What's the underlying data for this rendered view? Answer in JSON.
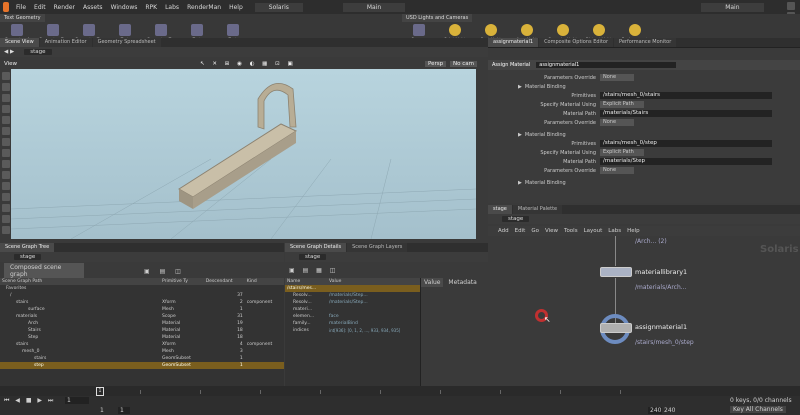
{
  "menubar": {
    "items": [
      "File",
      "Edit",
      "Render",
      "Assets",
      "Windows",
      "RPK",
      "Labs",
      "RenderMan",
      "Help"
    ],
    "context": "Solaris",
    "desktop": "Main"
  },
  "shelf": {
    "left_tab": "Text Geometry",
    "left_tools": [
      "Geometry_4",
      "Geometry_T...",
      "Geometry_T...",
      "Text Geometry_T...",
      "Geometry_T...",
      "Text Geometry_T...",
      "Text Geometry_T..."
    ],
    "right_tab": "USD Lights and Cameras",
    "right_tools": [
      "Camera",
      "Point Light",
      "Spot Light",
      "Area Light",
      "Specular Light",
      "Distant Light",
      "Environment Light"
    ]
  },
  "left_tabs": [
    "Scene View",
    "Animation Editor",
    "Geometry Spreadsheet"
  ],
  "right_tabs": [
    "assignmaterial1",
    "Composite Options Editor",
    "Performance Monitor"
  ],
  "left_path": "stage",
  "viewport": {
    "title": "View",
    "persp": "Persp",
    "cam": "No cam"
  },
  "parm": {
    "node_type": "Assign Material",
    "node_name": "assignmaterial1",
    "override_label": "Parameters Override",
    "override_value": "None",
    "bindings": [
      {
        "header": "Material Binding",
        "prim_label": "Primitives",
        "prim": "/stairs/mesh_0/stairs",
        "spec_label": "Specify Material Using",
        "spec": "Explicit Path",
        "mat_label": "Material Path",
        "mat": "/materials/Stairs",
        "ov_label": "Parameters Override",
        "ov": "None"
      },
      {
        "header": "Material Binding",
        "prim_label": "Primitives",
        "prim": "/stairs/mesh_0/step",
        "spec_label": "Specify Material Using",
        "spec": "Explicit Path",
        "mat_label": "Material Path",
        "mat": "/materials/Step",
        "ov_label": "Parameters Override",
        "ov": "None"
      }
    ],
    "last_header": "Material Binding"
  },
  "net": {
    "tabs": [
      "stage",
      "Material Palette"
    ],
    "path": "stage",
    "menu": [
      "Add",
      "Edit",
      "Go",
      "View",
      "Tools",
      "Layout",
      "Labs",
      "Help"
    ],
    "watermark": "Solaris",
    "top_node_path": "/Arch... (2)",
    "node1": {
      "name": "materiallibrary1",
      "sub": "/materials/Arch..."
    },
    "node2": {
      "name": "assignmaterial1",
      "sub": "/stairs/mesh_0/step"
    }
  },
  "tree": {
    "tabs": [
      "Scene Graph Tree"
    ],
    "path": "stage",
    "mode": "Composed scene graph",
    "cols": [
      "Scene Graph Path",
      "Primitive Ty",
      "Descendant",
      "Kind"
    ],
    "rows": [
      {
        "name": "Favorites",
        "type": "",
        "desc": "",
        "kind": ""
      },
      {
        "name": "/",
        "type": "",
        "desc": "37",
        "kind": ""
      },
      {
        "name": "stairs",
        "type": "Xform",
        "desc": "2",
        "kind": "component"
      },
      {
        "name": "surface",
        "type": "Mesh",
        "desc": "1",
        "kind": ""
      },
      {
        "name": "materials",
        "type": "Scope",
        "desc": "31",
        "kind": ""
      },
      {
        "name": "Arch",
        "type": "Material",
        "desc": "19",
        "kind": ""
      },
      {
        "name": "Stairs",
        "type": "Material",
        "desc": "18",
        "kind": ""
      },
      {
        "name": "Step",
        "type": "Material",
        "desc": "18",
        "kind": ""
      },
      {
        "name": "stairs",
        "type": "Xform",
        "desc": "4",
        "kind": "component"
      },
      {
        "name": "mesh_0",
        "type": "Mesh",
        "desc": "3",
        "kind": ""
      },
      {
        "name": "stairs",
        "type": "GeomSubset",
        "desc": "1",
        "kind": ""
      },
      {
        "name": "step",
        "type": "GeomSubset",
        "desc": "1",
        "kind": ""
      }
    ]
  },
  "details": {
    "tabs": [
      "Scene Graph Details",
      "Scene Graph Layers"
    ],
    "path": "stage",
    "cols": [
      "Name",
      "Value"
    ],
    "rows": [
      {
        "name": "/stairs/mes...",
        "value": ""
      },
      {
        "name": "Resolv...",
        "value": "/materials/Step..."
      },
      {
        "name": "Resolv...",
        "value": "/materials/Step..."
      },
      {
        "name": "materi...",
        "value": ""
      },
      {
        "name": "elemen...",
        "value": "face"
      },
      {
        "name": "family...",
        "value": "materialBind"
      },
      {
        "name": "indices",
        "value": "int[936]: [0, 1, 2, ..., 933, 934, 935]"
      }
    ],
    "side_tabs": [
      "Value",
      "Metadata"
    ]
  },
  "timeline": {
    "frame": "1",
    "start": "1",
    "end": "240",
    "end2": "240",
    "keys": "0 keys, 0/0 channels",
    "key_all": "Key All Channels"
  }
}
